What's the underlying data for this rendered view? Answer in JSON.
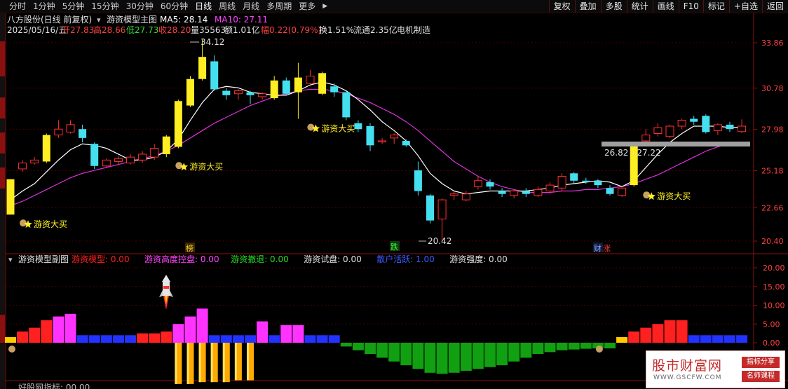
{
  "toolbar": {
    "periods": [
      "分时",
      "1分钟",
      "5分钟",
      "15分钟",
      "30分钟",
      "60分钟",
      "日线",
      "周线",
      "月线",
      "多周期",
      "更多"
    ],
    "active_period": "日线",
    "more_arrow": "▶",
    "tools": [
      "复权",
      "叠加",
      "多股",
      "统计",
      "画线",
      "F10",
      "标记",
      "+自选",
      "返回"
    ]
  },
  "main": {
    "title_line": {
      "stock": "八方股份(日线 前复权)",
      "indicator_name": "游资模型主图",
      "ma5_label": "MA5: 28.14",
      "ma10_label": "MA10: 27.11"
    },
    "info_line": {
      "date": "2025/05/16/五",
      "open": "开27.83",
      "high": "高28.66",
      "low": "低27.73",
      "close": "收28.20",
      "volume": "量35563",
      "amount": "额1.01亿",
      "change": "幅0.22(0.79%)",
      "turnover": "换1.51%",
      "float": "流通2.35亿",
      "industry": "电机制造"
    },
    "price_axis": [
      "33.86",
      "30.78",
      "27.98",
      "25.18",
      "22.66",
      "20.40"
    ],
    "annotations": {
      "high_mark": "34.12",
      "low_mark": "20.42",
      "range_label": "26.82 - 27.22",
      "buy_signal": "游资大买",
      "event_bang": "榜",
      "event_die": "跌",
      "event_cai": "财",
      "event_zhang": "涨"
    }
  },
  "sub": {
    "title": "游资模型副图",
    "legend": [
      {
        "label": "游资模型: 0.00",
        "color": "#ff2020"
      },
      {
        "label": "游资高度控盘: 0.00",
        "color": "#ff44ff"
      },
      {
        "label": "游资撤退: 0.00",
        "color": "#22dd22"
      },
      {
        "label": "游资试盘: 0.00",
        "color": "#e0e0e0"
      },
      {
        "label": "散户活跃: 1.00",
        "color": "#3b5bff"
      },
      {
        "label": "游资强度: 0.00",
        "color": "#e0e0e0"
      }
    ],
    "axis": [
      "20.00",
      "15.00",
      "10.00",
      "5.00",
      "0.00"
    ],
    "bottom_title": "好股网指标: 00.00"
  },
  "chart_data": {
    "type": "candlestick",
    "y_axis_ticks": [
      33.86,
      30.78,
      27.98,
      25.18,
      22.66,
      20.4
    ],
    "candles": [
      {
        "o": 22.2,
        "c": 24.6,
        "h": 24.6,
        "l": 22.2
      },
      {
        "o": 25.3,
        "c": 25.7,
        "h": 25.9,
        "l": 25.1
      },
      {
        "o": 25.7,
        "c": 25.9,
        "h": 26.1,
        "l": 25.6
      },
      {
        "o": 25.8,
        "c": 27.6,
        "h": 27.7,
        "l": 25.7
      },
      {
        "o": 27.6,
        "c": 28.0,
        "h": 28.6,
        "l": 27.4
      },
      {
        "o": 27.8,
        "c": 28.3,
        "h": 28.6,
        "l": 27.7
      },
      {
        "o": 28.0,
        "c": 27.4,
        "h": 28.3,
        "l": 27.1
      },
      {
        "o": 27.0,
        "c": 25.5,
        "h": 27.1,
        "l": 25.3
      },
      {
        "o": 25.5,
        "c": 25.9,
        "h": 26.0,
        "l": 25.4
      },
      {
        "o": 25.8,
        "c": 26.0,
        "h": 26.2,
        "l": 25.6
      },
      {
        "o": 25.7,
        "c": 26.1,
        "h": 26.3,
        "l": 25.6
      },
      {
        "o": 25.9,
        "c": 26.3,
        "h": 26.5,
        "l": 25.7
      },
      {
        "o": 26.1,
        "c": 26.7,
        "h": 27.0,
        "l": 25.9
      },
      {
        "o": 26.3,
        "c": 27.5,
        "h": 27.6,
        "l": 26.1
      },
      {
        "o": 26.8,
        "c": 29.9,
        "h": 30.0,
        "l": 26.7
      },
      {
        "o": 29.6,
        "c": 31.4,
        "h": 31.6,
        "l": 29.5
      },
      {
        "o": 31.4,
        "c": 32.9,
        "h": 34.12,
        "l": 31.3
      },
      {
        "o": 32.6,
        "c": 30.7,
        "h": 33.0,
        "l": 30.6
      },
      {
        "o": 30.6,
        "c": 30.3,
        "h": 30.8,
        "l": 30.0
      },
      {
        "o": 30.4,
        "c": 30.6,
        "h": 30.7,
        "l": 30.0
      },
      {
        "o": 30.5,
        "c": 30.3,
        "h": 30.6,
        "l": 29.7
      },
      {
        "o": 30.2,
        "c": 30.4,
        "h": 30.5,
        "l": 30.0
      },
      {
        "o": 30.1,
        "c": 31.3,
        "h": 31.6,
        "l": 30.0
      },
      {
        "o": 31.3,
        "c": 30.4,
        "h": 31.5,
        "l": 30.3
      },
      {
        "o": 30.5,
        "c": 31.5,
        "h": 32.5,
        "l": 28.7
      },
      {
        "o": 31.1,
        "c": 31.6,
        "h": 32.0,
        "l": 30.9
      },
      {
        "o": 30.4,
        "c": 31.8,
        "h": 31.9,
        "l": 30.3
      },
      {
        "o": 30.9,
        "c": 30.5,
        "h": 31.1,
        "l": 30.2
      },
      {
        "o": 30.5,
        "c": 28.8,
        "h": 30.6,
        "l": 28.6
      },
      {
        "o": 28.4,
        "c": 28.0,
        "h": 28.6,
        "l": 27.8
      },
      {
        "o": 28.2,
        "c": 26.9,
        "h": 28.4,
        "l": 26.5
      },
      {
        "o": 27.2,
        "c": 27.2,
        "h": 27.4,
        "l": 27.0
      },
      {
        "o": 27.4,
        "c": 27.6,
        "h": 27.7,
        "l": 27.0
      },
      {
        "o": 27.2,
        "c": 26.9,
        "h": 27.3,
        "l": 26.8
      },
      {
        "o": 25.2,
        "c": 23.8,
        "h": 25.8,
        "l": 23.5
      },
      {
        "o": 23.5,
        "c": 21.8,
        "h": 23.6,
        "l": 21.6
      },
      {
        "o": 21.9,
        "c": 23.2,
        "h": 23.3,
        "l": 20.42
      },
      {
        "o": 23.5,
        "c": 23.6,
        "h": 23.8,
        "l": 23.2
      },
      {
        "o": 23.2,
        "c": 23.6,
        "h": 23.8,
        "l": 23.1
      },
      {
        "o": 24.1,
        "c": 24.5,
        "h": 24.8,
        "l": 23.9
      },
      {
        "o": 24.4,
        "c": 24.1,
        "h": 24.6,
        "l": 23.9
      },
      {
        "o": 23.8,
        "c": 23.6,
        "h": 24.0,
        "l": 23.4
      },
      {
        "o": 23.5,
        "c": 23.8,
        "h": 23.9,
        "l": 23.3
      },
      {
        "o": 23.8,
        "c": 23.6,
        "h": 24.0,
        "l": 23.4
      },
      {
        "o": 23.5,
        "c": 23.9,
        "h": 24.1,
        "l": 23.4
      },
      {
        "o": 23.8,
        "c": 24.2,
        "h": 24.4,
        "l": 23.6
      },
      {
        "o": 24.0,
        "c": 24.8,
        "h": 25.0,
        "l": 23.8
      },
      {
        "o": 25.0,
        "c": 24.5,
        "h": 25.1,
        "l": 24.3
      },
      {
        "o": 24.5,
        "c": 24.4,
        "h": 24.7,
        "l": 24.3
      },
      {
        "o": 24.5,
        "c": 24.2,
        "h": 24.6,
        "l": 24.0
      },
      {
        "o": 24.0,
        "c": 23.6,
        "h": 24.2,
        "l": 23.5
      },
      {
        "o": 23.5,
        "c": 24.0,
        "h": 24.1,
        "l": 23.4
      },
      {
        "o": 24.2,
        "c": 26.82,
        "h": 27.0,
        "l": 24.1
      },
      {
        "o": 27.2,
        "c": 27.6,
        "h": 28.0,
        "l": 27.1
      },
      {
        "o": 27.7,
        "c": 28.1,
        "h": 28.4,
        "l": 27.5
      },
      {
        "o": 27.5,
        "c": 28.2,
        "h": 28.3,
        "l": 27.4
      },
      {
        "o": 28.2,
        "c": 28.6,
        "h": 28.7,
        "l": 28.0
      },
      {
        "o": 28.7,
        "c": 28.5,
        "h": 28.9,
        "l": 28.3
      },
      {
        "o": 28.9,
        "c": 27.8,
        "h": 29.0,
        "l": 27.7
      },
      {
        "o": 27.9,
        "c": 28.3,
        "h": 28.4,
        "l": 27.6
      },
      {
        "o": 28.3,
        "c": 28.0,
        "h": 28.5,
        "l": 27.8
      },
      {
        "o": 27.83,
        "c": 28.2,
        "h": 28.66,
        "l": 27.73
      }
    ],
    "big_candles": [
      0,
      3,
      13,
      14,
      15,
      16,
      17,
      22,
      24,
      26,
      34,
      35,
      52
    ],
    "ma5": [
      23.2,
      23.8,
      24.3,
      25.1,
      25.9,
      26.6,
      27.0,
      26.9,
      26.7,
      26.3,
      25.9,
      25.9,
      26.1,
      26.5,
      27.3,
      28.6,
      29.8,
      30.7,
      30.9,
      30.8,
      30.5,
      30.4,
      30.3,
      30.3,
      30.6,
      31.0,
      31.2,
      31.0,
      30.6,
      30.0,
      29.3,
      28.5,
      27.9,
      27.2,
      26.2,
      25.0,
      24.3,
      23.8,
      23.6,
      23.7,
      23.8,
      23.8,
      23.8,
      23.8,
      23.9,
      24.0,
      24.2,
      24.3,
      24.4,
      24.5,
      24.4,
      24.1,
      24.5,
      25.4,
      26.3,
      27.1,
      27.7,
      28.2,
      28.2,
      28.2,
      28.1,
      28.14
    ],
    "ma10": [
      22.8,
      23.1,
      23.5,
      23.9,
      24.3,
      24.7,
      25.0,
      25.2,
      25.4,
      25.6,
      25.8,
      26.0,
      26.2,
      26.5,
      26.9,
      27.4,
      27.9,
      28.4,
      28.8,
      29.2,
      29.6,
      29.9,
      30.2,
      30.4,
      30.6,
      30.7,
      30.7,
      30.6,
      30.4,
      30.1,
      29.8,
      29.4,
      29.0,
      28.5,
      27.9,
      27.2,
      26.5,
      25.8,
      25.3,
      24.8,
      24.4,
      24.1,
      23.9,
      23.7,
      23.7,
      23.7,
      23.8,
      23.8,
      23.9,
      23.9,
      24.0,
      24.1,
      24.3,
      24.6,
      24.9,
      25.3,
      25.7,
      26.1,
      26.5,
      26.8,
      27.0,
      27.11
    ],
    "sub_bars": [
      {
        "v": 1.5,
        "c": "y"
      },
      {
        "v": 3,
        "c": "r"
      },
      {
        "v": 4,
        "c": "r"
      },
      {
        "v": 6,
        "c": "r"
      },
      {
        "v": 7,
        "c": "m"
      },
      {
        "v": 7.7,
        "c": "m"
      },
      {
        "v": 2,
        "c": "b"
      },
      {
        "v": 2,
        "c": "b"
      },
      {
        "v": 2,
        "c": "b"
      },
      {
        "v": 2,
        "c": "b"
      },
      {
        "v": 2,
        "c": "b"
      },
      {
        "v": 2.5,
        "c": "r"
      },
      {
        "v": 2.5,
        "c": "r"
      },
      {
        "v": 3,
        "c": "r"
      },
      {
        "v": 5,
        "c": "m"
      },
      {
        "v": 7,
        "c": "m"
      },
      {
        "v": 9.1,
        "c": "m"
      },
      {
        "v": 2,
        "c": "b"
      },
      {
        "v": 2,
        "c": "b"
      },
      {
        "v": 2,
        "c": "b"
      },
      {
        "v": 2,
        "c": "b"
      },
      {
        "v": 5.7,
        "c": "m"
      },
      {
        "v": 2,
        "c": "b"
      },
      {
        "v": 4.7,
        "c": "m"
      },
      {
        "v": 4.7,
        "c": "m"
      },
      {
        "v": 2,
        "c": "b"
      },
      {
        "v": 2,
        "c": "b"
      },
      {
        "v": 2,
        "c": "b"
      },
      {
        "v": -1,
        "c": "g"
      },
      {
        "v": -2,
        "c": "g"
      },
      {
        "v": -3,
        "c": "g"
      },
      {
        "v": -4,
        "c": "g"
      },
      {
        "v": -5,
        "c": "g"
      },
      {
        "v": -6,
        "c": "g"
      },
      {
        "v": -7,
        "c": "g"
      },
      {
        "v": -8,
        "c": "g"
      },
      {
        "v": -8.3,
        "c": "g"
      },
      {
        "v": -8,
        "c": "g"
      },
      {
        "v": -7.5,
        "c": "g"
      },
      {
        "v": -7,
        "c": "g"
      },
      {
        "v": -6.5,
        "c": "g"
      },
      {
        "v": -6,
        "c": "g"
      },
      {
        "v": -5,
        "c": "g"
      },
      {
        "v": -4,
        "c": "g"
      },
      {
        "v": -3,
        "c": "g"
      },
      {
        "v": -2.5,
        "c": "g"
      },
      {
        "v": -2,
        "c": "g"
      },
      {
        "v": -1.8,
        "c": "g"
      },
      {
        "v": -1.6,
        "c": "g"
      },
      {
        "v": -1.5,
        "c": "g"
      },
      {
        "v": -1.5,
        "c": "g"
      },
      {
        "v": 1.5,
        "c": "y"
      },
      {
        "v": 3,
        "c": "r"
      },
      {
        "v": 4,
        "c": "r"
      },
      {
        "v": 5,
        "c": "r"
      },
      {
        "v": 6,
        "c": "r"
      },
      {
        "v": 6,
        "c": "r"
      },
      {
        "v": 2,
        "c": "b"
      },
      {
        "v": 2,
        "c": "b"
      },
      {
        "v": 2,
        "c": "b"
      },
      {
        "v": 2,
        "c": "b"
      },
      {
        "v": 2,
        "c": "b"
      }
    ],
    "orange_bars": [
      {
        "i": 14,
        "v": -11
      },
      {
        "i": 15,
        "v": -11
      },
      {
        "i": 16,
        "v": -10.5
      },
      {
        "i": 17,
        "v": -10.5
      },
      {
        "i": 18,
        "v": -10.5
      },
      {
        "i": 19,
        "v": -10
      },
      {
        "i": 20,
        "v": -10
      }
    ],
    "buy_signals": [
      0,
      13,
      24,
      52
    ],
    "sub_axis_ticks": [
      20,
      15,
      10,
      5,
      0
    ]
  }
}
